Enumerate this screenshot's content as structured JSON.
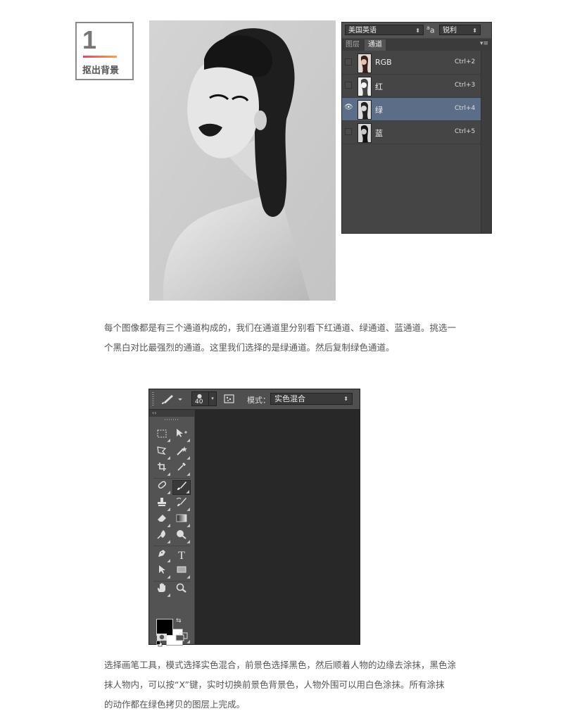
{
  "step": {
    "number": "1",
    "label": "抠出背景"
  },
  "colors": {
    "accent_gradient_start": "#e6426a",
    "accent_gradient_end": "#f5a44a",
    "ps_panel": "#454545",
    "ps_selected_row": "#5c6e87"
  },
  "channels_panel": {
    "language": "美国英语",
    "aa_icon": "aa-anti-alias-icon",
    "aa_label": "a",
    "sharpness": "锐利",
    "tabs": [
      {
        "label": "图层",
        "active": false
      },
      {
        "label": "通道",
        "active": true
      }
    ],
    "channels": [
      {
        "name": "RGB",
        "shortcut": "Ctrl+2",
        "visible": false,
        "selected": false
      },
      {
        "name": "红",
        "shortcut": "Ctrl+3",
        "visible": false,
        "selected": false
      },
      {
        "name": "绿",
        "shortcut": "Ctrl+4",
        "visible": true,
        "selected": true
      },
      {
        "name": "蓝",
        "shortcut": "Ctrl+5",
        "visible": false,
        "selected": false
      }
    ]
  },
  "paragraph1": {
    "line1": "每个图像都是有三个通道构成的，我们在通道里分别看下红通道、绿通道、蓝通道。挑选一",
    "line2": "个黑白对比最强烈的通道。这里我们选择的是绿通道。然后复制绿色通道。"
  },
  "photoshop": {
    "brush_size": "40",
    "mode_label": "模式：",
    "mode_value": "实色混合",
    "collapse_glyph": "‹‹",
    "tools": [
      "rectangular-marquee-tool",
      "move-tool",
      "polygonal-lasso-tool",
      "magic-wand-tool",
      "crop-tool",
      "eyedropper-tool",
      "spot-healing-brush-tool",
      "brush-tool",
      "clone-stamp-tool",
      "history-brush-tool",
      "eraser-tool",
      "gradient-tool",
      "blur-tool",
      "dodge-tool",
      "pen-tool",
      "type-tool",
      "path-selection-tool",
      "rectangle-tool",
      "hand-tool",
      "zoom-tool"
    ],
    "type_tool_glyph": "T",
    "selected_tool": "brush-tool",
    "foreground_color": "#000000",
    "background_color": "#ffffff"
  },
  "paragraph2": {
    "line1": "选择画笔工具，模式选择实色混合，前景色选择黑色，然后顺着人物的边缘去涂抹，黑色涂",
    "line2": "抹人物内，可以按“X”键，实时切换前景色背景色，人物外围可以用白色涂抹。所有涂抹",
    "line3": "的动作都在绿色拷贝的图层上完成。"
  }
}
